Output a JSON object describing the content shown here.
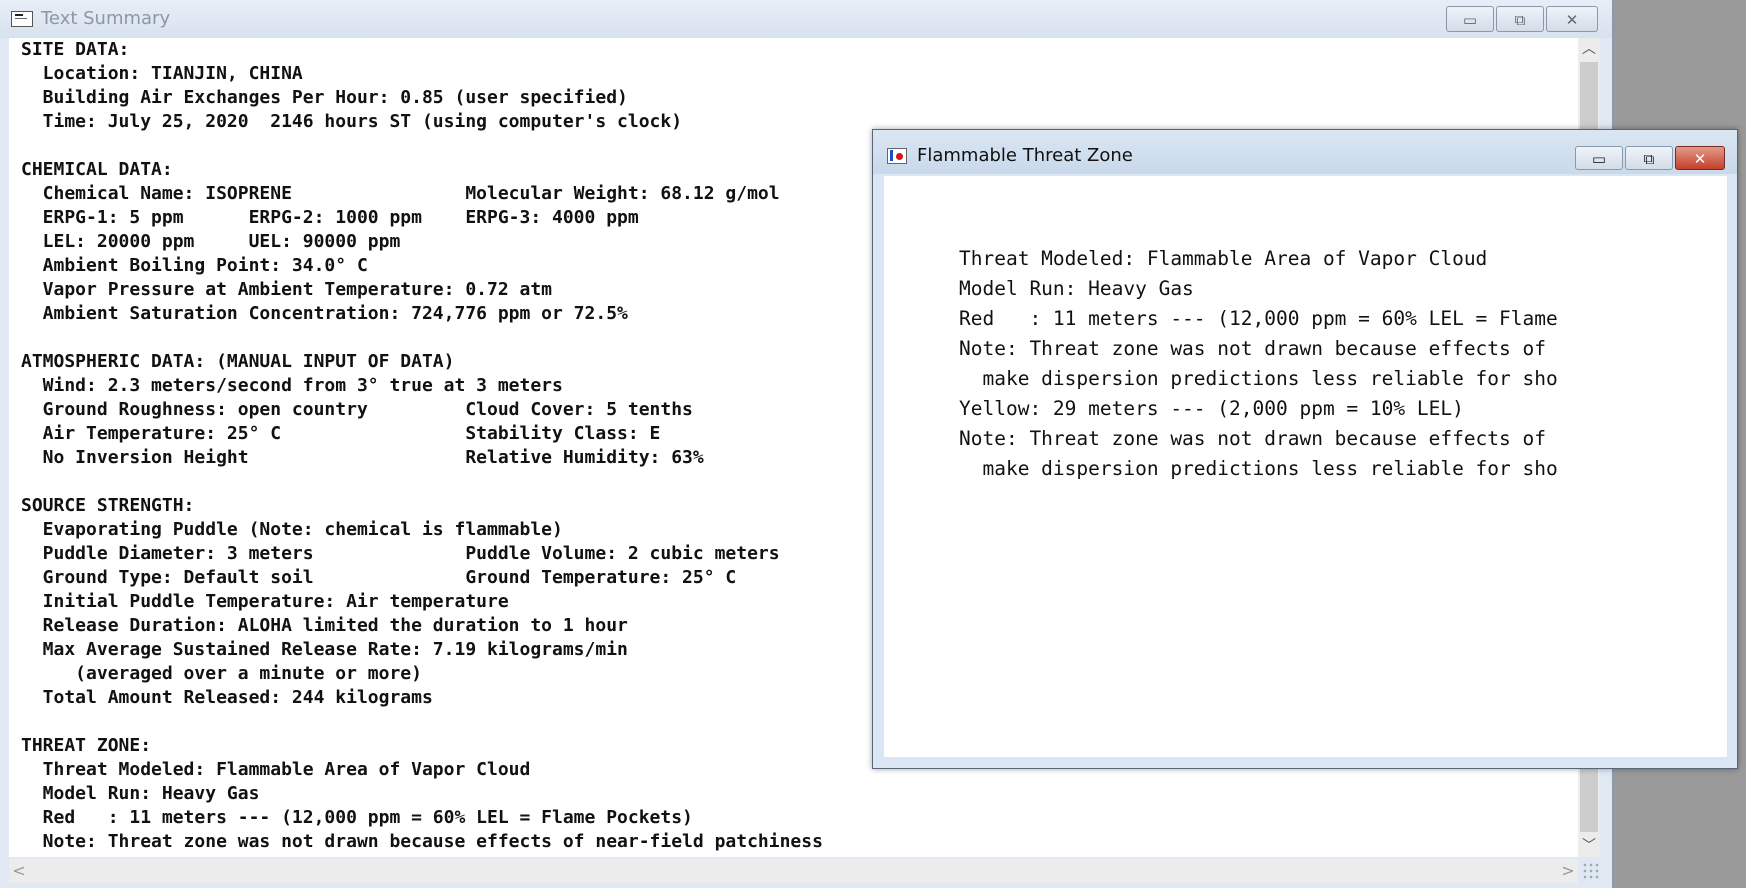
{
  "main_window": {
    "title": "Text Summary",
    "controls": {
      "minimize": "▭",
      "maximize": "⧉",
      "close": "✕"
    },
    "report_lines": [
      "SITE DATA:",
      "  Location: TIANJIN, CHINA",
      "  Building Air Exchanges Per Hour: 0.85 (user specified)",
      "  Time: July 25, 2020  2146 hours ST (using computer's clock)",
      "",
      "CHEMICAL DATA:",
      "  Chemical Name: ISOPRENE                Molecular Weight: 68.12 g/mol",
      "  ERPG-1: 5 ppm      ERPG-2: 1000 ppm    ERPG-3: 4000 ppm",
      "  LEL: 20000 ppm     UEL: 90000 ppm",
      "  Ambient Boiling Point: 34.0° C",
      "  Vapor Pressure at Ambient Temperature: 0.72 atm",
      "  Ambient Saturation Concentration: 724,776 ppm or 72.5%",
      "",
      "ATMOSPHERIC DATA: (MANUAL INPUT OF DATA)",
      "  Wind: 2.3 meters/second from 3° true at 3 meters",
      "  Ground Roughness: open country         Cloud Cover: 5 tenths",
      "  Air Temperature: 25° C                 Stability Class: E",
      "  No Inversion Height                    Relative Humidity: 63%",
      "",
      "SOURCE STRENGTH:",
      "  Evaporating Puddle (Note: chemical is flammable)",
      "  Puddle Diameter: 3 meters              Puddle Volume: 2 cubic meters",
      "  Ground Type: Default soil              Ground Temperature: 25° C",
      "  Initial Puddle Temperature: Air temperature",
      "  Release Duration: ALOHA limited the duration to 1 hour",
      "  Max Average Sustained Release Rate: 7.19 kilograms/min",
      "     (averaged over a minute or more)",
      "  Total Amount Released: 244 kilograms",
      "",
      "THREAT ZONE:",
      "  Threat Modeled: Flammable Area of Vapor Cloud",
      "  Model Run: Heavy Gas",
      "  Red   : 11 meters --- (12,000 ppm = 60% LEL = Flame Pockets)",
      "  Note: Threat zone was not drawn because effects of near-field patchiness"
    ],
    "scroll": {
      "up": "︿",
      "down": "﹀",
      "left": "<",
      "right": ">"
    }
  },
  "popup_window": {
    "title": "Flammable Threat Zone",
    "controls": {
      "minimize": "▭",
      "maximize": "⧉",
      "close": "✕"
    },
    "lines": [
      "Threat Modeled: Flammable Area of Vapor Cloud",
      "Model Run: Heavy Gas",
      "Red   : 11 meters --- (12,000 ppm = 60% LEL = Flame",
      "Note: Threat zone was not drawn because effects of",
      "  make dispersion predictions less reliable for sho",
      "Yellow: 29 meters --- (2,000 ppm = 10% LEL)",
      "Note: Threat zone was not drawn because effects of",
      "  make dispersion predictions less reliable for sho"
    ]
  }
}
